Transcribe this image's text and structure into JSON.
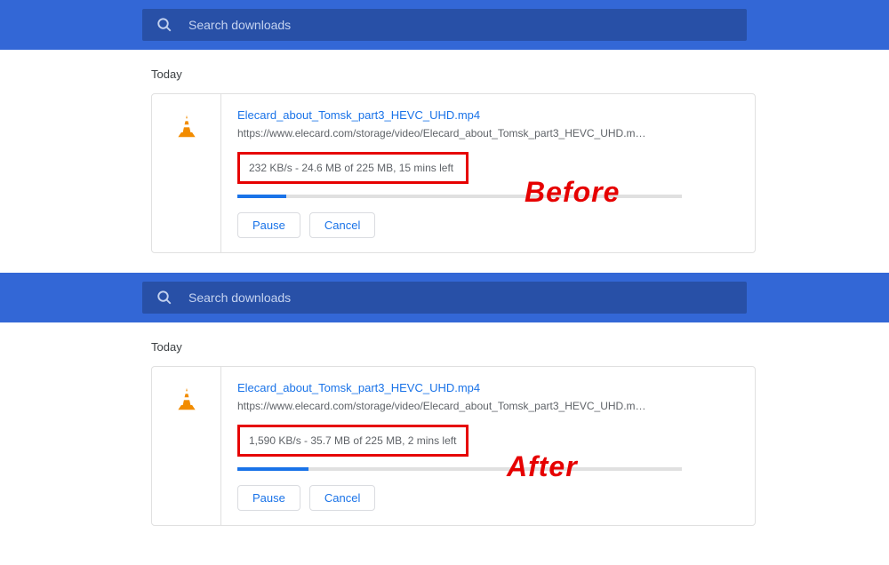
{
  "search": {
    "placeholder": "Search downloads"
  },
  "sections": {
    "before": {
      "label": "Today",
      "annotation": "Before",
      "file": {
        "name": "Elecard_about_Tomsk_part3_HEVC_UHD.mp4",
        "url": "https://www.elecard.com/storage/video/Elecard_about_Tomsk_part3_HEVC_UHD.m…",
        "status": "232 KB/s - 24.6 MB of 225 MB, 15 mins left",
        "progress_percent": 11
      }
    },
    "after": {
      "label": "Today",
      "annotation": "After",
      "file": {
        "name": "Elecard_about_Tomsk_part3_HEVC_UHD.mp4",
        "url": "https://www.elecard.com/storage/video/Elecard_about_Tomsk_part3_HEVC_UHD.m…",
        "status": "1,590 KB/s - 35.7 MB of 225 MB, 2 mins left",
        "progress_percent": 16
      }
    }
  },
  "buttons": {
    "pause": "Pause",
    "cancel": "Cancel"
  },
  "colors": {
    "header": "#3367d6",
    "search_bg": "#2850a7",
    "link": "#1a73e8",
    "highlight_border": "#e60000"
  }
}
